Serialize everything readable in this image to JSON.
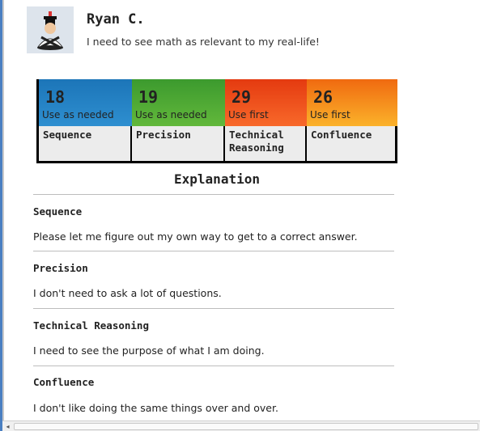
{
  "profile": {
    "name": "Ryan C.",
    "quote": "I need to see math as relevant to my real-life!",
    "avatar_icon": "student-avatar-icon"
  },
  "stats": [
    {
      "score": "18",
      "usage": "Use as needed",
      "label": "Sequence",
      "color": "#1c75b8"
    },
    {
      "score": "19",
      "usage": "Use as needed",
      "label": "Precision",
      "color": "#3c9a2e"
    },
    {
      "score": "29",
      "usage": "Use first",
      "label": "Technical Reasoning",
      "color": "#e43a10"
    },
    {
      "score": "26",
      "usage": "Use first",
      "label": "Confluence",
      "color": "#f08a18"
    }
  ],
  "explanation": {
    "title": "Explanation",
    "sections": [
      {
        "heading": "Sequence",
        "text": "Please let me figure out my own way to get to a correct answer."
      },
      {
        "heading": "Precision",
        "text": "I don't need to ask a lot of questions."
      },
      {
        "heading": "Technical Reasoning",
        "text": "I need to see the purpose of what I am doing."
      },
      {
        "heading": "Confluence",
        "text": "I don't like doing the same things over and over."
      }
    ]
  },
  "scrollbar": {
    "left_arrow": "◂"
  }
}
